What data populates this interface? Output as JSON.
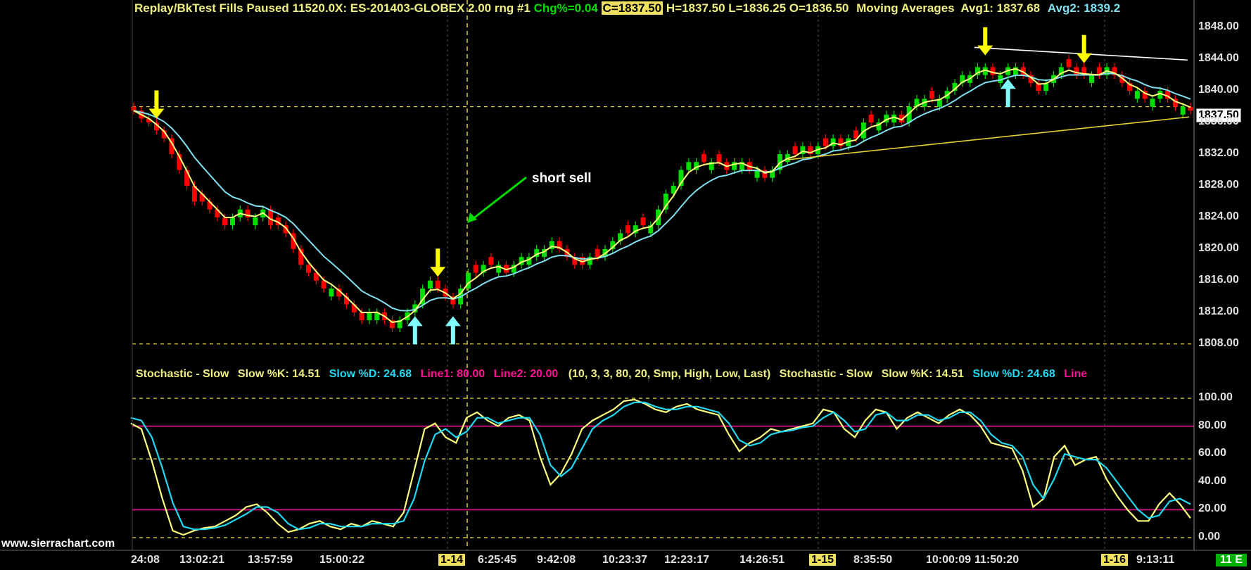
{
  "header": {
    "title": "Replay/BkTest Fills  Paused 11520.0X: ES-201403-GLOBEX  2.00 rng  #1",
    "change": "Chg%=0.04",
    "close": "C=1837.50",
    "ohl": "H=1837.50  L=1836.25  O=1836.50",
    "ma_label": "Moving Averages",
    "avg1": "Avg1: 1837.68",
    "avg2": "Avg2: 1839.2"
  },
  "stoch_header": {
    "name": "Stochastic - Slow",
    "k": "Slow %K: 14.51",
    "d": "Slow %D: 24.68",
    "line1": "Line1: 80.00",
    "line2": "Line2: 20.00",
    "params": "(10, 3, 3, 80, 20, Smp, High, Low, Last)",
    "name2": "Stochastic - Slow",
    "k2": "Slow %K: 14.51",
    "d2": "Slow %D: 24.68",
    "line1_trunc": "Line"
  },
  "price_axis": [
    "1848.00",
    "1844.00",
    "1840.00",
    "1836.00",
    "1832.00",
    "1828.00",
    "1824.00",
    "1820.00",
    "1816.00",
    "1812.00",
    "1808.00"
  ],
  "last_price": "1837.50",
  "stoch_axis": [
    "100.00",
    "80.00",
    "60.00",
    "40.00",
    "20.00",
    "0.00"
  ],
  "time_axis": [
    "24:08",
    "13:02:21",
    "13:57:59",
    "15:00:22",
    "1-14",
    "6:25:45",
    "9:42:08",
    "10:23:37",
    "12:23:17",
    "14:26:51",
    "1-15",
    "8:35:50",
    "10:00:09",
    "11:50:20",
    "1-16",
    "9:13:11"
  ],
  "annotation": "short sell",
  "watermark": "www.sierrachart.com",
  "bar_counter": "11 E",
  "colors": {
    "background": "#000000",
    "up_candle": "#00e000",
    "down_candle": "#ff0000",
    "avg1": "#ffff80",
    "avg2": "#80e0f0",
    "stoch_k": "#ffff80",
    "stoch_d": "#20d8f0",
    "ref_lines": "#ff1090",
    "sell_arrow": "#ffff00",
    "buy_arrow": "#80ffff"
  },
  "chart_data": [
    {
      "type": "candlestick",
      "symbol": "ES-201403-GLOBEX",
      "bar_type": "2.00 range",
      "ylim": [
        1807,
        1849
      ],
      "close": [
        1837.5,
        1836.5,
        1836,
        1835,
        1834,
        1832,
        1830,
        1828,
        1826,
        1826,
        1825,
        1824,
        1823,
        1824,
        1825,
        1824,
        1824,
        1825,
        1823,
        1823,
        1822,
        1820,
        1818,
        1817,
        1816,
        1815,
        1815,
        1814,
        1813,
        1812,
        1811,
        1812,
        1812,
        1811,
        1810,
        1811,
        1812,
        1813,
        1815,
        1816,
        1815,
        1814,
        1813,
        1815,
        1817,
        1817,
        1818,
        1818,
        1818,
        1817,
        1818,
        1819,
        1819,
        1820,
        1820,
        1821,
        1820,
        1819,
        1818,
        1818,
        1819,
        1819,
        1820,
        1821,
        1822,
        1822,
        1823,
        1823,
        1823,
        1825,
        1827,
        1828,
        1830,
        1831,
        1831,
        1831,
        1831,
        1831,
        1830,
        1831,
        1831,
        1830,
        1830,
        1829,
        1830,
        1832,
        1832,
        1832,
        1833,
        1832,
        1833,
        1833,
        1834,
        1833,
        1834,
        1834,
        1836,
        1836,
        1836,
        1837,
        1837,
        1836,
        1838,
        1839,
        1839,
        1839,
        1839,
        1840,
        1841,
        1842,
        1842,
        1843,
        1843,
        1842,
        1842,
        1843,
        1843,
        1842,
        1841,
        1840,
        1841,
        1842,
        1843,
        1843,
        1842,
        1842,
        1842,
        1842,
        1843,
        1842,
        1841,
        1840,
        1840,
        1839,
        1839,
        1840,
        1839,
        1838,
        1838,
        1837.5
      ],
      "avg1_last": 1837.68,
      "avg2_last": 1839.2,
      "signals": [
        {
          "type": "sell",
          "bar": 3
        },
        {
          "type": "buy",
          "bar": 37
        },
        {
          "type": "sell",
          "bar": 40
        },
        {
          "type": "buy",
          "bar": 42
        },
        {
          "type": "sell",
          "bar": 112
        },
        {
          "type": "buy",
          "bar": 115
        },
        {
          "type": "sell",
          "bar": 125
        }
      ],
      "annotation": "short sell"
    },
    {
      "type": "line",
      "title": "Stochastic - Slow",
      "ylim": [
        -3,
        103
      ],
      "reference_lines": [
        80,
        20
      ],
      "series": [
        {
          "name": "Slow %K",
          "values": [
            82,
            78,
            55,
            28,
            5,
            2,
            5,
            7,
            8,
            12,
            16,
            22,
            24,
            18,
            10,
            4,
            6,
            10,
            12,
            8,
            6,
            10,
            8,
            12,
            10,
            8,
            18,
            48,
            78,
            82,
            72,
            68,
            86,
            90,
            84,
            80,
            86,
            88,
            84,
            58,
            38,
            46,
            60,
            78,
            84,
            88,
            92,
            98,
            99,
            96,
            92,
            90,
            94,
            96,
            92,
            90,
            88,
            74,
            62,
            68,
            72,
            78,
            76,
            78,
            80,
            82,
            92,
            90,
            78,
            72,
            84,
            92,
            90,
            78,
            86,
            90,
            86,
            82,
            88,
            92,
            88,
            80,
            68,
            66,
            64,
            48,
            22,
            28,
            58,
            66,
            52,
            56,
            58,
            42,
            30,
            20,
            12,
            12,
            24,
            32,
            24,
            14
          ]
        },
        {
          "name": "Slow %D",
          "values": [
            86,
            84,
            72,
            50,
            25,
            8,
            6,
            6,
            7,
            9,
            13,
            17,
            22,
            22,
            18,
            10,
            6,
            7,
            10,
            10,
            8,
            8,
            8,
            10,
            10,
            10,
            12,
            28,
            55,
            74,
            78,
            72,
            76,
            86,
            86,
            82,
            84,
            86,
            86,
            74,
            52,
            44,
            50,
            64,
            78,
            84,
            88,
            94,
            97,
            97,
            94,
            92,
            92,
            94,
            94,
            92,
            90,
            82,
            70,
            66,
            68,
            74,
            76,
            77,
            79,
            80,
            86,
            90,
            84,
            76,
            78,
            88,
            90,
            84,
            84,
            88,
            88,
            84,
            86,
            90,
            90,
            84,
            74,
            68,
            66,
            58,
            38,
            28,
            42,
            60,
            58,
            56,
            56,
            50,
            40,
            30,
            20,
            14,
            16,
            26,
            28,
            24
          ]
        }
      ]
    }
  ]
}
